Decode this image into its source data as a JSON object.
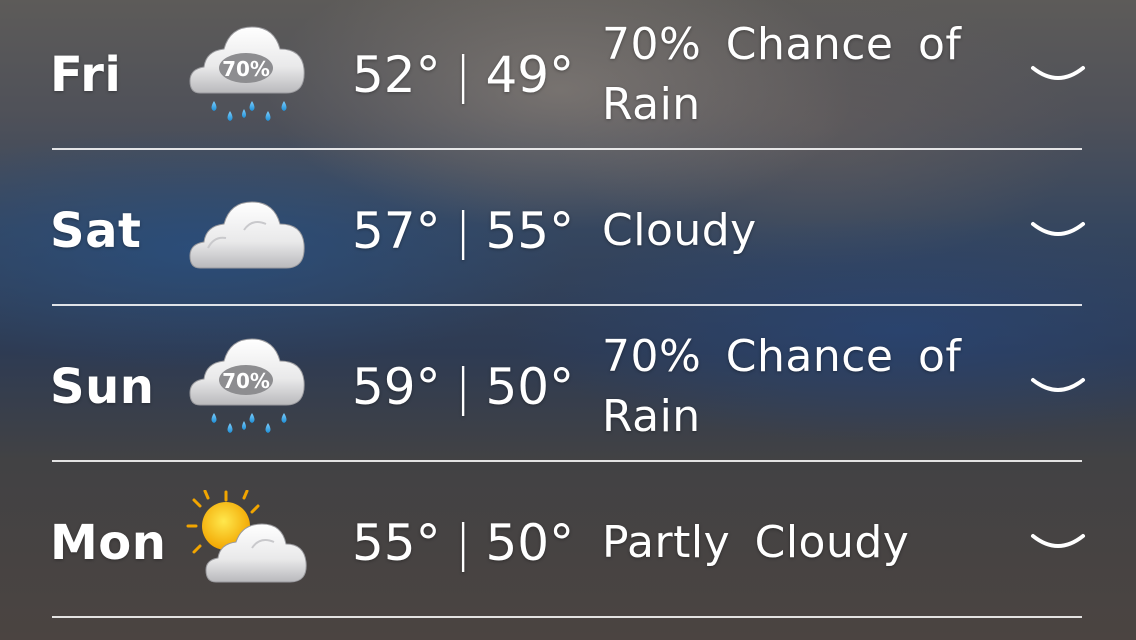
{
  "forecast": [
    {
      "day": "Fri",
      "high": "52°",
      "low": "49°",
      "separator": "|",
      "condition": "70% Chance of Rain",
      "icon": "rain-cloud-icon",
      "icon_label": "70%"
    },
    {
      "day": "Sat",
      "high": "57°",
      "low": "55°",
      "separator": "|",
      "condition": "Cloudy",
      "icon": "cloud-icon"
    },
    {
      "day": "Sun",
      "high": "59°",
      "low": "50°",
      "separator": "|",
      "condition": "70% Chance of Rain",
      "icon": "rain-cloud-icon",
      "icon_label": "70%"
    },
    {
      "day": "Mon",
      "high": "55°",
      "low": "50°",
      "separator": "|",
      "condition": "Partly Cloudy",
      "icon": "partly-cloudy-icon"
    }
  ],
  "colors": {
    "text": "#ffffff",
    "divider": "#ffffff",
    "rain_drop": "#3aa6e6",
    "sun": "#f5b800"
  }
}
